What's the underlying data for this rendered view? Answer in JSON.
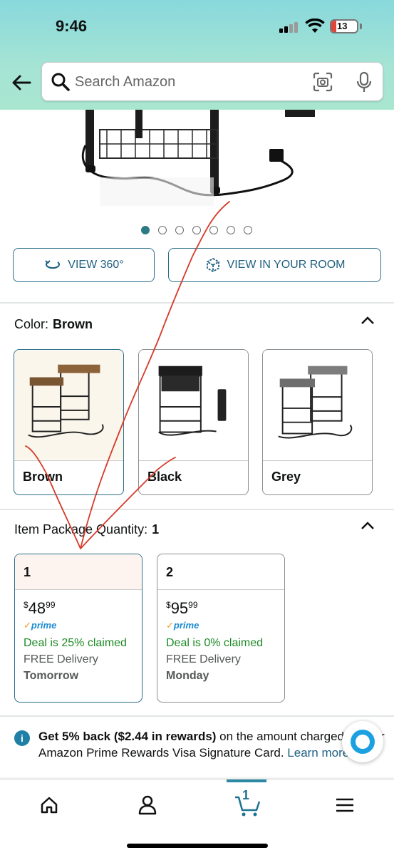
{
  "status": {
    "time": "9:46",
    "battery": "13"
  },
  "search": {
    "placeholder": "Search Amazon"
  },
  "carousel": {
    "total": 7,
    "active": 1
  },
  "view_buttons": {
    "view360": "VIEW 360°",
    "view_room": "VIEW IN YOUR ROOM"
  },
  "color": {
    "label": "Color:",
    "selected": "Brown",
    "options": [
      {
        "name": "Brown"
      },
      {
        "name": "Black"
      },
      {
        "name": "Grey"
      }
    ]
  },
  "quantity": {
    "label": "Item Package Quantity:",
    "selected": "1",
    "options": [
      {
        "qty": "1",
        "price_whole": "48",
        "price_frac": "99",
        "$": "$",
        "prime": "prime",
        "deal": "Deal is 25% claimed",
        "delivery": "FREE Delivery",
        "day": "Tomorrow"
      },
      {
        "qty": "2",
        "price_whole": "95",
        "price_frac": "99",
        "$": "$",
        "prime": "prime",
        "deal": "Deal is 0% claimed",
        "delivery": "FREE Delivery",
        "day": "Monday"
      }
    ]
  },
  "rewards": {
    "bold": "Get 5% back ($2.44 in rewards)",
    "text": " on the amount charged to your Amazon Prime Rewards Visa Signature Card.",
    "link": " Learn more."
  },
  "nav": {
    "cart_count": "1"
  },
  "colors": {
    "accent": "#2c6f8a",
    "deal_green": "#1d8a25",
    "annotation_red": "#d63a2a"
  }
}
